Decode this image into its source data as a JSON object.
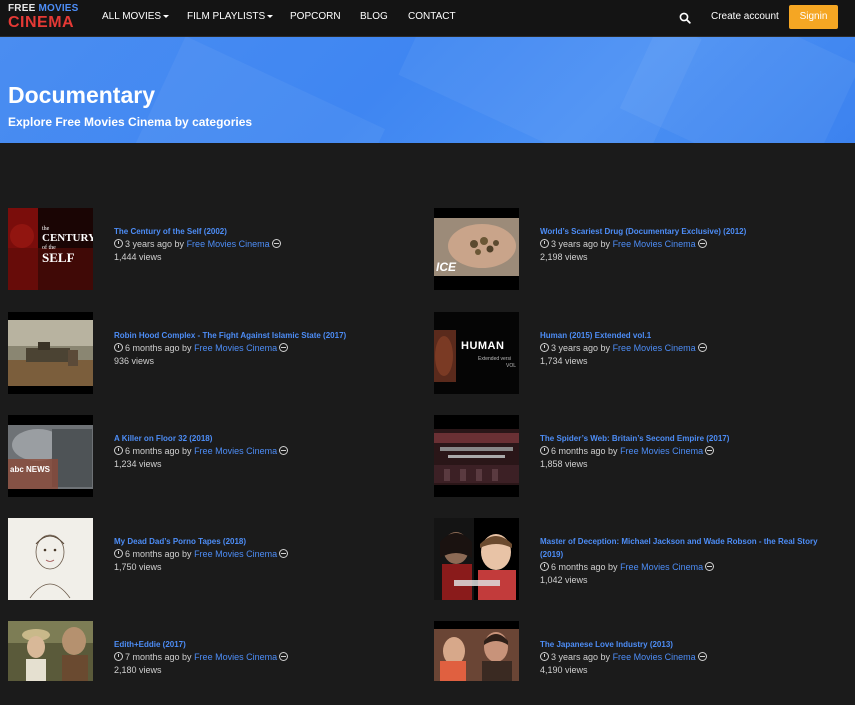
{
  "nav": {
    "logo_line1_a": "FREE ",
    "logo_line1_b": "MOVIES",
    "logo_line2": "CINEMA",
    "all_movies": "ALL MOVIES",
    "film_playlists": "FILM PLAYLISTS",
    "popcorn": "POPCORN",
    "blog": "BLOG",
    "contact": "CONTACT",
    "create_account": "Create account",
    "signin": "Signin"
  },
  "hero": {
    "title": "Documentary",
    "subtitle": "Explore Free Movies Cinema by categories"
  },
  "items": [
    {
      "title": "The Century of the Self (2002)",
      "ago": "3 years ago by",
      "author": "Free Movies Cinema",
      "views": "1,444 views"
    },
    {
      "title": "World’s Scariest Drug (Documentary Exclusive) (2012)",
      "ago": "3 years ago by",
      "author": "Free Movies Cinema",
      "views": "2,198 views"
    },
    {
      "title": "Robin Hood Complex - The Fight Against Islamic State (2017)",
      "ago": "6 months ago by",
      "author": "Free Movies Cinema",
      "views": "936 views"
    },
    {
      "title": "Human (2015) Extended vol.1",
      "ago": "3 years ago by",
      "author": "Free Movies Cinema",
      "views": "1,734 views"
    },
    {
      "title": "A Killer on Floor 32 (2018)",
      "ago": "6 months ago by",
      "author": "Free Movies Cinema",
      "views": "1,234 views"
    },
    {
      "title": "The Spider’s Web: Britain’s Second Empire (2017)",
      "ago": "6 months ago by",
      "author": "Free Movies Cinema",
      "views": "1,858 views"
    },
    {
      "title": "My Dead Dad’s Porno Tapes (2018)",
      "ago": "6 months ago by",
      "author": "Free Movies Cinema",
      "views": "1,750 views"
    },
    {
      "title": "Master of Deception: Michael Jackson and Wade Robson - the Real Story (2019)",
      "ago": "6 months ago by",
      "author": "Free Movies Cinema",
      "views": "1,042 views"
    },
    {
      "title": "Edith+Eddie (2017)",
      "ago": "7 months ago by",
      "author": "Free Movies Cinema",
      "views": "2,180 views"
    },
    {
      "title": "The Japanese Love Industry (2013)",
      "ago": "3 years ago by",
      "author": "Free Movies Cinema",
      "views": "4,190 views"
    }
  ],
  "thumbs": {
    "century_line1": "the",
    "century_line2": "CENTURY",
    "century_line3": "of the",
    "century_line4": "SELF",
    "vice_logo": "ICE",
    "human_text": "HUMAN",
    "human_sub1": "Extended versi",
    "human_sub2": "VOL",
    "abc_logo": "abc NEWS"
  },
  "colors": {
    "accent": "#4d8df6",
    "signin": "#f5a623",
    "hero": "#3f86f2",
    "background": "#1b1b1b",
    "logo_red": "#e53935"
  }
}
